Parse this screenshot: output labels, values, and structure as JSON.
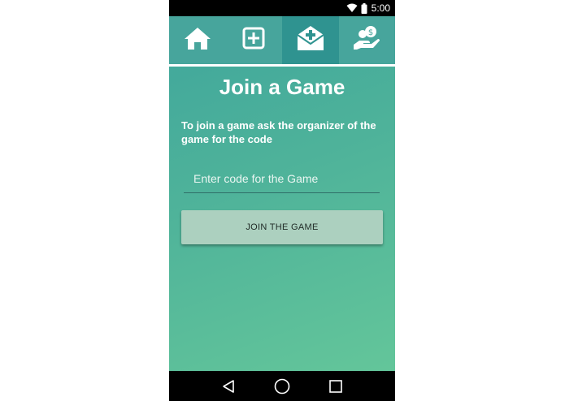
{
  "status_bar": {
    "time": "5:00",
    "icons": [
      "wifi-icon",
      "battery-icon"
    ]
  },
  "tabs": [
    {
      "name": "home",
      "icon": "home-icon",
      "active": false
    },
    {
      "name": "create-game",
      "icon": "plus-square-icon",
      "active": false
    },
    {
      "name": "join-game",
      "icon": "envelope-plus-icon",
      "active": true
    },
    {
      "name": "donate",
      "icon": "hand-coins-icon",
      "active": false
    }
  ],
  "page": {
    "title": "Join a Game",
    "instructions": "To join a game ask the organizer of the game for the code",
    "code_input": {
      "value": "",
      "placeholder": "Enter code for the Game"
    },
    "join_button_label": "JOIN THE GAME"
  },
  "nav_bar": {
    "icons": [
      "back-icon",
      "home-circle-icon",
      "recents-icon"
    ]
  },
  "colors": {
    "accent_tab": "#2f9390",
    "background_top": "#3ea59c",
    "background_bottom": "#66c89a",
    "button": "#acd0bf"
  }
}
